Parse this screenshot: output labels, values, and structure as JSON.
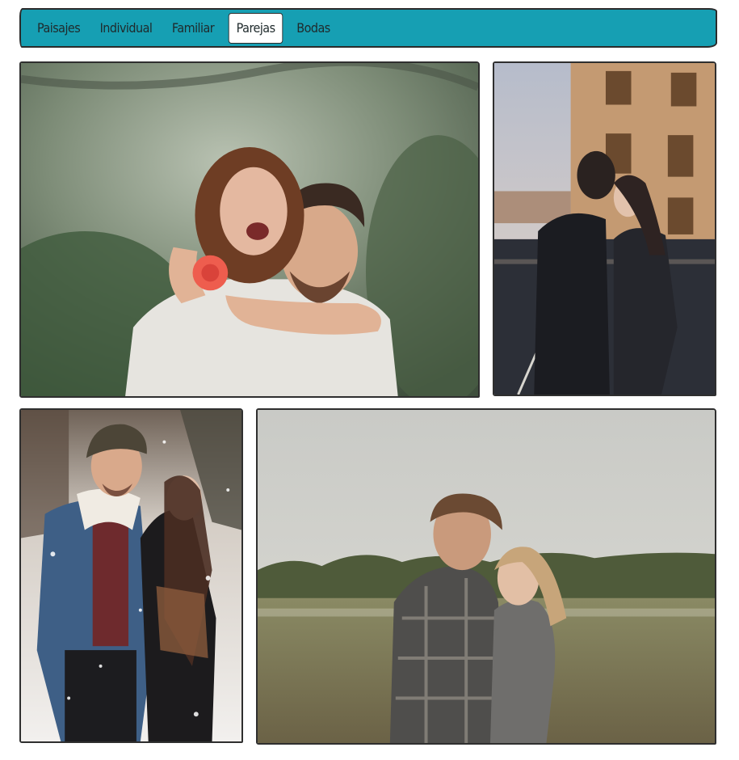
{
  "nav": {
    "tabs": [
      {
        "label": "Paisajes"
      },
      {
        "label": "Individual"
      },
      {
        "label": "Familiar"
      },
      {
        "label": "Parejas"
      },
      {
        "label": "Bodas"
      }
    ],
    "active_tab": "Parejas",
    "background_color": "#169fb3"
  },
  "gallery": {
    "photos": [
      {
        "subject": "couple-piggyback-forest",
        "dominant_color": "#5f6f5c"
      },
      {
        "subject": "couple-street-brick-building",
        "dominant_color": "#3a3a3f"
      },
      {
        "subject": "couple-snow-forest",
        "dominant_color": "#d9d5cf"
      },
      {
        "subject": "couple-embrace-field",
        "dominant_color": "#8b8466"
      }
    ]
  }
}
